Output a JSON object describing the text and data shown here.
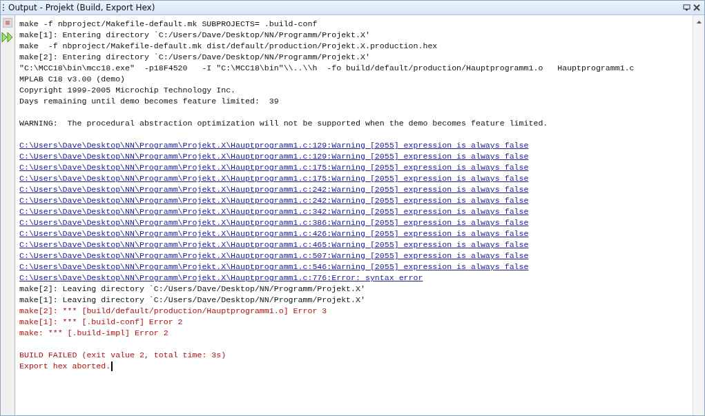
{
  "window": {
    "title": "Output - Projekt (Build, Export Hex)"
  },
  "toolbar": {
    "stop": {
      "disabled": true
    },
    "rerun": {
      "disabled": false
    }
  },
  "lines": [
    {
      "kind": "plain",
      "text": "make -f nbproject/Makefile-default.mk SUBPROJECTS= .build-conf"
    },
    {
      "kind": "plain",
      "text": "make[1]: Entering directory `C:/Users/Dave/Desktop/NN/Programm/Projekt.X'"
    },
    {
      "kind": "plain",
      "text": "make  -f nbproject/Makefile-default.mk dist/default/production/Projekt.X.production.hex"
    },
    {
      "kind": "plain",
      "text": "make[2]: Entering directory `C:/Users/Dave/Desktop/NN/Programm/Projekt.X'"
    },
    {
      "kind": "plain",
      "text": "\"C:\\MCC18\\bin\\mcc18.exe\"  -p18F4520   -I \"C:\\MCC18\\bin\"\\\\..\\\\h  -fo build/default/production/Hauptprogramm1.o   Hauptprogramm1.c"
    },
    {
      "kind": "plain",
      "text": "MPLAB C18 v3.00 (demo)"
    },
    {
      "kind": "plain",
      "text": "Copyright 1999-2005 Microchip Technology Inc."
    },
    {
      "kind": "plain",
      "text": "Days remaining until demo becomes feature limited:  39"
    },
    {
      "kind": "blank"
    },
    {
      "kind": "plain",
      "text": "WARNING:  The procedural abstraction optimization will not be supported when the demo becomes feature limited."
    },
    {
      "kind": "blank"
    },
    {
      "kind": "link",
      "text": "C:\\Users\\Dave\\Desktop\\NN\\Programm\\Projekt.X\\Hauptprogramm1.c:129:Warning [2055] expression is always false"
    },
    {
      "kind": "link",
      "text": "C:\\Users\\Dave\\Desktop\\NN\\Programm\\Projekt.X\\Hauptprogramm1.c:129:Warning [2055] expression is always false"
    },
    {
      "kind": "link",
      "text": "C:\\Users\\Dave\\Desktop\\NN\\Programm\\Projekt.X\\Hauptprogramm1.c:175:Warning [2055] expression is always false"
    },
    {
      "kind": "link",
      "text": "C:\\Users\\Dave\\Desktop\\NN\\Programm\\Projekt.X\\Hauptprogramm1.c:175:Warning [2055] expression is always false"
    },
    {
      "kind": "link",
      "text": "C:\\Users\\Dave\\Desktop\\NN\\Programm\\Projekt.X\\Hauptprogramm1.c:242:Warning [2055] expression is always false"
    },
    {
      "kind": "link",
      "text": "C:\\Users\\Dave\\Desktop\\NN\\Programm\\Projekt.X\\Hauptprogramm1.c:242:Warning [2055] expression is always false"
    },
    {
      "kind": "link",
      "text": "C:\\Users\\Dave\\Desktop\\NN\\Programm\\Projekt.X\\Hauptprogramm1.c:342:Warning [2055] expression is always false"
    },
    {
      "kind": "link",
      "text": "C:\\Users\\Dave\\Desktop\\NN\\Programm\\Projekt.X\\Hauptprogramm1.c:386:Warning [2055] expression is always false"
    },
    {
      "kind": "link",
      "text": "C:\\Users\\Dave\\Desktop\\NN\\Programm\\Projekt.X\\Hauptprogramm1.c:426:Warning [2055] expression is always false"
    },
    {
      "kind": "link",
      "text": "C:\\Users\\Dave\\Desktop\\NN\\Programm\\Projekt.X\\Hauptprogramm1.c:465:Warning [2055] expression is always false"
    },
    {
      "kind": "link",
      "text": "C:\\Users\\Dave\\Desktop\\NN\\Programm\\Projekt.X\\Hauptprogramm1.c:507:Warning [2055] expression is always false"
    },
    {
      "kind": "link",
      "text": "C:\\Users\\Dave\\Desktop\\NN\\Programm\\Projekt.X\\Hauptprogramm1.c:546:Warning [2055] expression is always false"
    },
    {
      "kind": "link",
      "text": "C:\\Users\\Dave\\Desktop\\NN\\Programm\\Projekt.X\\Hauptprogramm1.c:776:Error: syntax error"
    },
    {
      "kind": "plain",
      "text": "make[2]: Leaving directory `C:/Users/Dave/Desktop/NN/Programm/Projekt.X'"
    },
    {
      "kind": "plain",
      "text": "make[1]: Leaving directory `C:/Users/Dave/Desktop/NN/Programm/Projekt.X'"
    },
    {
      "kind": "error",
      "text": "make[2]: *** [build/default/production/Hauptprogramm1.o] Error 3"
    },
    {
      "kind": "error",
      "text": "make[1]: *** [.build-conf] Error 2"
    },
    {
      "kind": "error",
      "text": "make: *** [.build-impl] Error 2"
    },
    {
      "kind": "blank"
    },
    {
      "kind": "error",
      "text": "BUILD FAILED (exit value 2, total time: 3s)"
    },
    {
      "kind": "error",
      "text": "Export hex aborted.",
      "cursor": true
    }
  ]
}
